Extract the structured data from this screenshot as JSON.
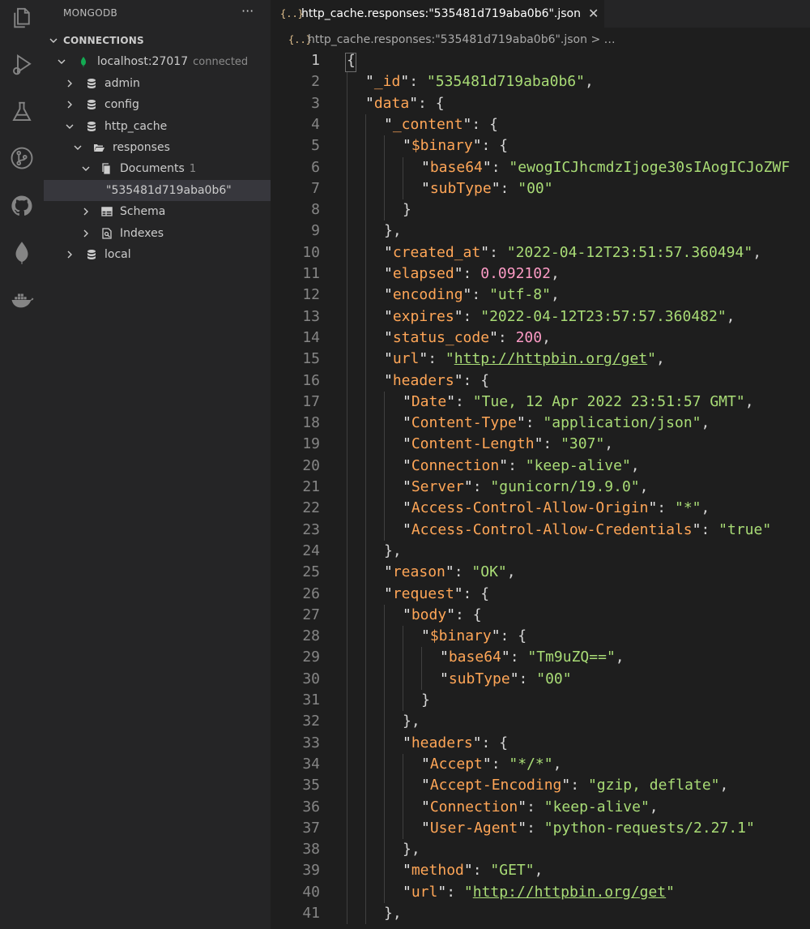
{
  "activity": {
    "icons": [
      "files-icon",
      "run-debug-icon",
      "flask-icon",
      "source-control-icon",
      "github-icon",
      "mongodb-leaf-icon",
      "docker-icon"
    ]
  },
  "sidebar": {
    "title": "MONGODB",
    "more": "···",
    "section": "CONNECTIONS",
    "connection": {
      "name": "localhost:27017",
      "status": "connected"
    },
    "databases": {
      "admin": "admin",
      "config": "config",
      "http_cache": "http_cache",
      "local": "local"
    },
    "collection": "responses",
    "documents": {
      "label": "Documents",
      "count": "1"
    },
    "document_id": "\"535481d719aba0b6\"",
    "schema": "Schema",
    "indexes": "Indexes"
  },
  "editor": {
    "tab_label": "http_cache.responses:\"535481d719aba0b6\".json",
    "tab_close": "✕",
    "json_glyph": "{..}",
    "breadcrumb": "http_cache.responses:\"535481d719aba0b6\".json > …",
    "lines": [
      {
        "ln": "1",
        "level": 0,
        "key": "",
        "value": "",
        "vt": "",
        "link": false,
        "suffix": "{"
      },
      {
        "ln": "2",
        "level": 1,
        "key": "_id",
        "value": "\"535481d719aba0b6\"",
        "vt": "s",
        "link": false,
        "suffix": ","
      },
      {
        "ln": "3",
        "level": 1,
        "key": "data",
        "value": "",
        "vt": "",
        "link": false,
        "suffix": "{"
      },
      {
        "ln": "4",
        "level": 2,
        "key": "_content",
        "value": "",
        "vt": "",
        "link": false,
        "suffix": "{"
      },
      {
        "ln": "5",
        "level": 3,
        "key": "$binary",
        "value": "",
        "vt": "",
        "link": false,
        "suffix": "{"
      },
      {
        "ln": "6",
        "level": 4,
        "key": "base64",
        "value": "\"ewogICJhcmdzIjoge30sIAogICJoZWF",
        "vt": "s",
        "link": false,
        "suffix": ""
      },
      {
        "ln": "7",
        "level": 4,
        "key": "subType",
        "value": "\"00\"",
        "vt": "s",
        "link": false,
        "suffix": ""
      },
      {
        "ln": "8",
        "level": 3,
        "key": "",
        "value": "",
        "vt": "",
        "link": false,
        "suffix": "}"
      },
      {
        "ln": "9",
        "level": 2,
        "key": "",
        "value": "",
        "vt": "",
        "link": false,
        "suffix": "},"
      },
      {
        "ln": "10",
        "level": 2,
        "key": "created_at",
        "value": "\"2022-04-12T23:51:57.360494\"",
        "vt": "s",
        "link": false,
        "suffix": ","
      },
      {
        "ln": "11",
        "level": 2,
        "key": "elapsed",
        "value": "0.092102",
        "vt": "n",
        "link": false,
        "suffix": ","
      },
      {
        "ln": "12",
        "level": 2,
        "key": "encoding",
        "value": "\"utf-8\"",
        "vt": "s",
        "link": false,
        "suffix": ","
      },
      {
        "ln": "13",
        "level": 2,
        "key": "expires",
        "value": "\"2022-04-12T23:57:57.360482\"",
        "vt": "s",
        "link": false,
        "suffix": ","
      },
      {
        "ln": "14",
        "level": 2,
        "key": "status_code",
        "value": "200",
        "vt": "n",
        "link": false,
        "suffix": ","
      },
      {
        "ln": "15",
        "level": 2,
        "key": "url",
        "value": "http://httpbin.org/get",
        "vt": "s",
        "link": true,
        "suffix": ","
      },
      {
        "ln": "16",
        "level": 2,
        "key": "headers",
        "value": "",
        "vt": "",
        "link": false,
        "suffix": "{"
      },
      {
        "ln": "17",
        "level": 3,
        "key": "Date",
        "value": "\"Tue, 12 Apr 2022 23:51:57 GMT\"",
        "vt": "s",
        "link": false,
        "suffix": ","
      },
      {
        "ln": "18",
        "level": 3,
        "key": "Content-Type",
        "value": "\"application/json\"",
        "vt": "s",
        "link": false,
        "suffix": ","
      },
      {
        "ln": "19",
        "level": 3,
        "key": "Content-Length",
        "value": "\"307\"",
        "vt": "s",
        "link": false,
        "suffix": ","
      },
      {
        "ln": "20",
        "level": 3,
        "key": "Connection",
        "value": "\"keep-alive\"",
        "vt": "s",
        "link": false,
        "suffix": ","
      },
      {
        "ln": "21",
        "level": 3,
        "key": "Server",
        "value": "\"gunicorn/19.9.0\"",
        "vt": "s",
        "link": false,
        "suffix": ","
      },
      {
        "ln": "22",
        "level": 3,
        "key": "Access-Control-Allow-Origin",
        "value": "\"*\"",
        "vt": "s",
        "link": false,
        "suffix": ","
      },
      {
        "ln": "23",
        "level": 3,
        "key": "Access-Control-Allow-Credentials",
        "value": "\"true\"",
        "vt": "s",
        "link": false,
        "suffix": ""
      },
      {
        "ln": "24",
        "level": 2,
        "key": "",
        "value": "",
        "vt": "",
        "link": false,
        "suffix": "},"
      },
      {
        "ln": "25",
        "level": 2,
        "key": "reason",
        "value": "\"OK\"",
        "vt": "s",
        "link": false,
        "suffix": ","
      },
      {
        "ln": "26",
        "level": 2,
        "key": "request",
        "value": "",
        "vt": "",
        "link": false,
        "suffix": "{"
      },
      {
        "ln": "27",
        "level": 3,
        "key": "body",
        "value": "",
        "vt": "",
        "link": false,
        "suffix": "{"
      },
      {
        "ln": "28",
        "level": 4,
        "key": "$binary",
        "value": "",
        "vt": "",
        "link": false,
        "suffix": "{"
      },
      {
        "ln": "29",
        "level": 5,
        "key": "base64",
        "value": "\"Tm9uZQ==\"",
        "vt": "s",
        "link": false,
        "suffix": ","
      },
      {
        "ln": "30",
        "level": 5,
        "key": "subType",
        "value": "\"00\"",
        "vt": "s",
        "link": false,
        "suffix": ""
      },
      {
        "ln": "31",
        "level": 4,
        "key": "",
        "value": "",
        "vt": "",
        "link": false,
        "suffix": "}"
      },
      {
        "ln": "32",
        "level": 3,
        "key": "",
        "value": "",
        "vt": "",
        "link": false,
        "suffix": "},"
      },
      {
        "ln": "33",
        "level": 3,
        "key": "headers",
        "value": "",
        "vt": "",
        "link": false,
        "suffix": "{"
      },
      {
        "ln": "34",
        "level": 4,
        "key": "Accept",
        "value": "\"*/*\"",
        "vt": "s",
        "link": false,
        "suffix": ","
      },
      {
        "ln": "35",
        "level": 4,
        "key": "Accept-Encoding",
        "value": "\"gzip, deflate\"",
        "vt": "s",
        "link": false,
        "suffix": ","
      },
      {
        "ln": "36",
        "level": 4,
        "key": "Connection",
        "value": "\"keep-alive\"",
        "vt": "s",
        "link": false,
        "suffix": ","
      },
      {
        "ln": "37",
        "level": 4,
        "key": "User-Agent",
        "value": "\"python-requests/2.27.1\"",
        "vt": "s",
        "link": false,
        "suffix": ""
      },
      {
        "ln": "38",
        "level": 3,
        "key": "",
        "value": "",
        "vt": "",
        "link": false,
        "suffix": "},"
      },
      {
        "ln": "39",
        "level": 3,
        "key": "method",
        "value": "\"GET\"",
        "vt": "s",
        "link": false,
        "suffix": ","
      },
      {
        "ln": "40",
        "level": 3,
        "key": "url",
        "value": "http://httpbin.org/get",
        "vt": "s",
        "link": true,
        "suffix": ""
      },
      {
        "ln": "41",
        "level": 2,
        "key": "",
        "value": "",
        "vt": "",
        "link": false,
        "suffix": "},"
      }
    ]
  },
  "colors": {
    "key": "#ffa657",
    "string": "#a9dc76",
    "number": "#fc9bc5",
    "mongodb_green": "#13aa52",
    "json_icon": "#e2c08d"
  }
}
